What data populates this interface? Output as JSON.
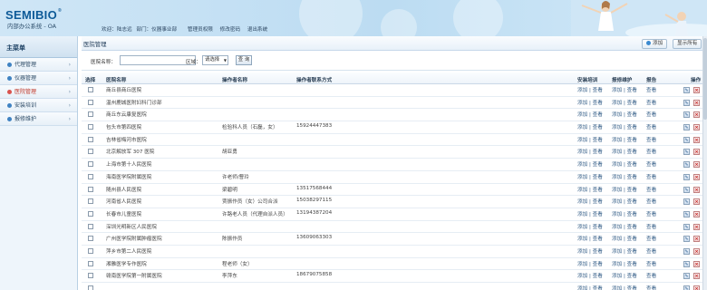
{
  "header": {
    "logo": "SEMIBIO",
    "logo_mark": "®",
    "subtitle": "内部办公系统 - OA",
    "welcome": "欢迎：陆志远",
    "dept": "部门：仪器事业部",
    "links": [
      "管理员权限",
      "修改密码",
      "退出系统"
    ]
  },
  "sidebar": {
    "title": "主菜单",
    "items": [
      {
        "label": "代理管理"
      },
      {
        "label": "仪器管理"
      },
      {
        "label": "医院管理"
      },
      {
        "label": "安装培训"
      },
      {
        "label": "报修维护"
      }
    ]
  },
  "main": {
    "tab_title": "医院管理",
    "add_label": "添加",
    "show_all_label": "显示所有",
    "filter": {
      "hospital_label": "医院名称：",
      "hospital_value": "",
      "area_label": "区域：",
      "area_value": "请选择",
      "query_label": "查 询"
    },
    "columns": {
      "select": "选择",
      "name": "医院名称",
      "operator": "操作者名称",
      "phone": "操作者联系方式",
      "train": "安装培训",
      "cert": "报修维护",
      "report": "报告",
      "action": "操作"
    },
    "link_add": "添加",
    "link_sep": "|",
    "link_view": "查看",
    "link_report": "查看",
    "rows": [
      {
        "name": "商丘县商丘医院",
        "operator": "",
        "phone": ""
      },
      {
        "name": "温州鹿城医附妇科门诊部",
        "operator": "",
        "phone": ""
      },
      {
        "name": "商丘东云康复医院",
        "operator": "",
        "phone": ""
      },
      {
        "name": "包头市第四医院",
        "operator": "检验科人员（石磊，女）",
        "phone": "15924447383"
      },
      {
        "name": "吉林省梅河市医院",
        "operator": "",
        "phone": ""
      },
      {
        "name": "北京解放军 307 医院",
        "operator": "胡亚勇",
        "phone": ""
      },
      {
        "name": "上海市第十人民医院",
        "operator": "",
        "phone": ""
      },
      {
        "name": "海南医学院附属医院",
        "operator": "许老师/曹玲",
        "phone": ""
      },
      {
        "name": "随州县人民医院",
        "operator": "梁碧明",
        "phone": "13517568444"
      },
      {
        "name": "河南省人民医院",
        "operator": "贾振作员（女）公司合派",
        "phone": "15038297115"
      },
      {
        "name": "长春市儿童医院",
        "operator": "许路老人员（代理自派人员）",
        "phone": "13194387204"
      },
      {
        "name": "深圳光明新区人民医院",
        "operator": "",
        "phone": ""
      },
      {
        "name": "广州医学院附属肿瘤医院",
        "operator": "陈振作员",
        "phone": "13609063303"
      },
      {
        "name": "萍乡市第二人民医院",
        "operator": "",
        "phone": ""
      },
      {
        "name": "湘雅医学专作医院",
        "operator": "程老师（女）",
        "phone": ""
      },
      {
        "name": "赣南医学院第一附属医院",
        "operator": "李萍东",
        "phone": "18679075858"
      },
      {
        "name": "",
        "operator": "",
        "phone": ""
      }
    ]
  },
  "icons": {
    "edit": "edit-icon",
    "delete": "delete-icon",
    "add": "add-icon"
  },
  "colors": {
    "brand": "#0d5a98",
    "header_bg": "#cfe6f6",
    "delete": "#c0201e"
  }
}
